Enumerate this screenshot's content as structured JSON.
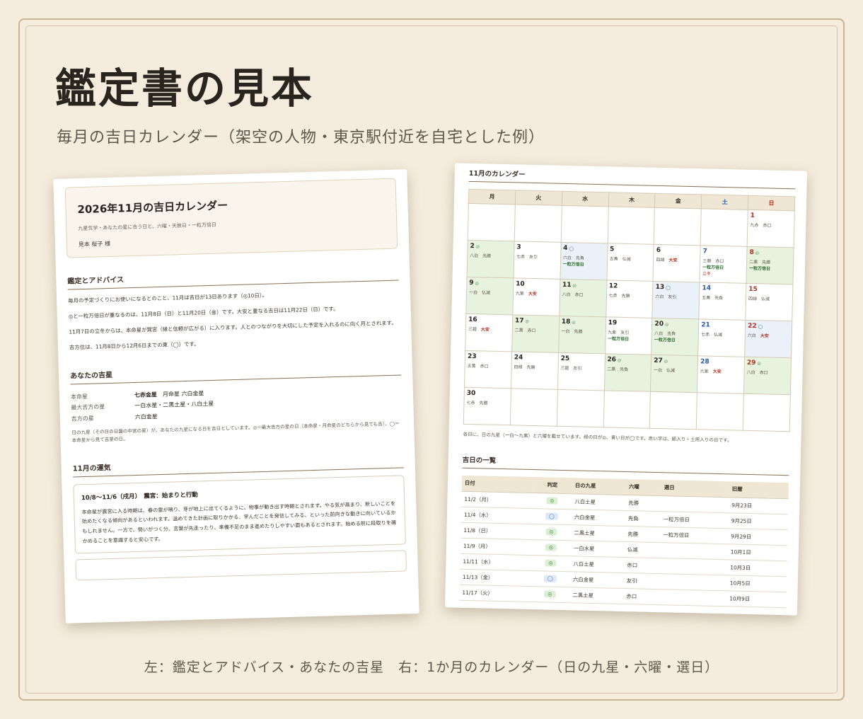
{
  "title": "鑑定書の見本",
  "subtitle": "毎月の吉日カレンダー（架空の人物・東京駅付近を自宅とした例）",
  "caption": "左：鑑定とアドバイス・あなたの吉星　右：1か月のカレンダー（日の九星・六曜・選日）",
  "left_page": {
    "header": {
      "title": "2026年11月の吉日カレンダー",
      "desc": "九星気学・あなたの星に合う日と、六曜・天赦日・一粒万倍日",
      "name": "見本 桜子 様"
    },
    "advice": {
      "heading": "鑑定とアドバイス",
      "paragraphs": [
        "毎月の予定づくりにお使いになるとのこと、11月は吉日が13日あります（◎10日）。",
        "◎と一粒万倍日が重なるのは、11月8日（日）と11月20日（金）です。大安と重なる吉日は11月22日（日）です。",
        "11月7日の立冬からは、本命星が巽宮（縁と信頼が広がる）に入ります。人とのつながりを大切にした予定を入れるのに向く月とされます。",
        "吉方位は、11月8日から12月6日までの東（◯）です。"
      ]
    },
    "stars": {
      "heading": "あなたの吉星",
      "rows": [
        {
          "key": "本命星",
          "value_bold": "七赤金星",
          "value": "　月命星 六白金星"
        },
        {
          "key": "最大吉方の星",
          "value_bold": "",
          "value": "一白水星・二黒土星・八白土星"
        },
        {
          "key": "吉方の星",
          "value_bold": "",
          "value": "六白金星"
        }
      ],
      "note": "日の九星（その日の日盤の中宮の星）が、あなたの九星になる日を吉日としています。◎＝最大吉方の星の日（本命星・月命星のどちらから見ても吉）、◯＝本命星から見て吉星の日。"
    },
    "fortune": {
      "heading": "11月の運気",
      "card_title": "10/8〜11/6（戌月）　震宮：始まりと行動",
      "card_text": "本命星が震宮に入る時期は、春の雷が鳴り、芽が地上に出てくるように、物事が動き出す時期とされます。やる気が高まり、新しいことを始めたくなる傾向があるといわれます。温めてきた計画に取りかかる、学んだことを発信してみる、といった前向きな動きに向いているかもしれません。一方で、勢いがつく分、言葉が先走ったり、準備不足のまま進めたりしやすい面もあるとされます。始める前に段取りを確かめることを意識すると安心です。"
    }
  },
  "right_page": {
    "calendar": {
      "heading": "11月のカレンダー",
      "weekdays": [
        "月",
        "火",
        "水",
        "木",
        "金",
        "土",
        "日"
      ],
      "cells": [
        {
          "d": "",
          "info": ""
        },
        {
          "d": "",
          "info": ""
        },
        {
          "d": "",
          "info": ""
        },
        {
          "d": "",
          "info": ""
        },
        {
          "d": "",
          "info": ""
        },
        {
          "d": "",
          "info": ""
        },
        {
          "d": "1",
          "info": "九赤　赤口",
          "cls": "sun"
        },
        {
          "d": "2",
          "mark": "◎",
          "info": "八白　先勝",
          "bg": "g"
        },
        {
          "d": "3",
          "info": "七赤　友引"
        },
        {
          "d": "4",
          "mark": "◯",
          "info": "六白　先負",
          "extra": "一粒万倍日",
          "bg": "b"
        },
        {
          "d": "5",
          "info": "五黄　仏滅"
        },
        {
          "d": "6",
          "info": "四緑　",
          "red": "大安"
        },
        {
          "d": "7",
          "info": "三碧　赤口",
          "extra": "一粒万倍日",
          "extra2": "立冬",
          "cls": "sat"
        },
        {
          "d": "8",
          "mark": "◎",
          "info": "二黒　先勝",
          "extra": "一粒万倍日",
          "bg": "g",
          "cls": "sun"
        },
        {
          "d": "9",
          "mark": "◎",
          "info": "一白　仏滅",
          "bg": "g"
        },
        {
          "d": "10",
          "info": "九紫　",
          "red": "大安"
        },
        {
          "d": "11",
          "mark": "◎",
          "info": "八白　赤口",
          "bg": "g"
        },
        {
          "d": "12",
          "info": "七赤　先勝"
        },
        {
          "d": "13",
          "mark": "◯",
          "info": "六白　友引",
          "bg": "b"
        },
        {
          "d": "14",
          "info": "五黄　先負",
          "cls": "sat"
        },
        {
          "d": "15",
          "info": "四緑　仏滅",
          "cls": "sun"
        },
        {
          "d": "16",
          "info": "三碧　",
          "red": "大安"
        },
        {
          "d": "17",
          "mark": "◎",
          "info": "二黒　赤口",
          "bg": "g"
        },
        {
          "d": "18",
          "mark": "◎",
          "info": "一白　先勝",
          "bg": "g"
        },
        {
          "d": "19",
          "info": "九紫　友引",
          "extra": "一粒万倍日"
        },
        {
          "d": "20",
          "mark": "◎",
          "info": "八白　先負",
          "extra": "一粒万倍日",
          "bg": "g"
        },
        {
          "d": "21",
          "info": "七赤　仏滅",
          "cls": "sat"
        },
        {
          "d": "22",
          "mark": "◯",
          "info": "六白　",
          "red": "大安",
          "bg": "b",
          "cls": "sun"
        },
        {
          "d": "23",
          "info": "五黄　赤口"
        },
        {
          "d": "24",
          "info": "四緑　先勝"
        },
        {
          "d": "25",
          "info": "三碧　友引"
        },
        {
          "d": "26",
          "mark": "◎",
          "info": "二黒　先負",
          "bg": "g"
        },
        {
          "d": "27",
          "mark": "◎",
          "info": "一白　仏滅",
          "bg": "g"
        },
        {
          "d": "28",
          "info": "九紫　",
          "red": "大安",
          "cls": "sat"
        },
        {
          "d": "29",
          "mark": "◎",
          "info": "八白　赤口",
          "bg": "g",
          "cls": "sun"
        },
        {
          "d": "30",
          "info": "七赤　先勝"
        },
        {
          "d": "",
          "info": ""
        },
        {
          "d": "",
          "info": ""
        },
        {
          "d": "",
          "info": ""
        },
        {
          "d": "",
          "info": ""
        },
        {
          "d": "",
          "info": ""
        },
        {
          "d": "",
          "info": ""
        }
      ],
      "note": "各日に、日の九星（一白〜九紫）と六曜を載せています。緑の日が◎、青い日が◯です。赤い字は、節入り・土用入りの日です。"
    },
    "list": {
      "heading": "吉日の一覧",
      "headers": [
        "日付",
        "判定",
        "日の九星",
        "六曜",
        "選日",
        "旧暦"
      ],
      "rows": [
        {
          "date": "11/2（月）",
          "mark": "◎",
          "star": "八白土星",
          "rokuyo": "先勝",
          "senjitsu": "",
          "kyureki": "9月23日"
        },
        {
          "date": "11/4（水）",
          "mark": "◯",
          "star": "六白金星",
          "rokuyo": "先負",
          "senjitsu": "一粒万倍日",
          "kyureki": "9月25日"
        },
        {
          "date": "11/8（日）",
          "mark": "◎",
          "star": "二黒土星",
          "rokuyo": "先勝",
          "senjitsu": "一粒万倍日",
          "kyureki": "9月29日"
        },
        {
          "date": "11/9（月）",
          "mark": "◎",
          "star": "一白水星",
          "rokuyo": "仏滅",
          "senjitsu": "",
          "kyureki": "10月1日"
        },
        {
          "date": "11/11（水）",
          "mark": "◎",
          "star": "八白土星",
          "rokuyo": "赤口",
          "senjitsu": "",
          "kyureki": "10月3日"
        },
        {
          "date": "11/13（金）",
          "mark": "◯",
          "star": "六白金星",
          "rokuyo": "友引",
          "senjitsu": "",
          "kyureki": "10月5日"
        },
        {
          "date": "11/17（火）",
          "mark": "◎",
          "star": "二黒土星",
          "rokuyo": "赤口",
          "senjitsu": "",
          "kyureki": "10月9日"
        }
      ]
    }
  }
}
